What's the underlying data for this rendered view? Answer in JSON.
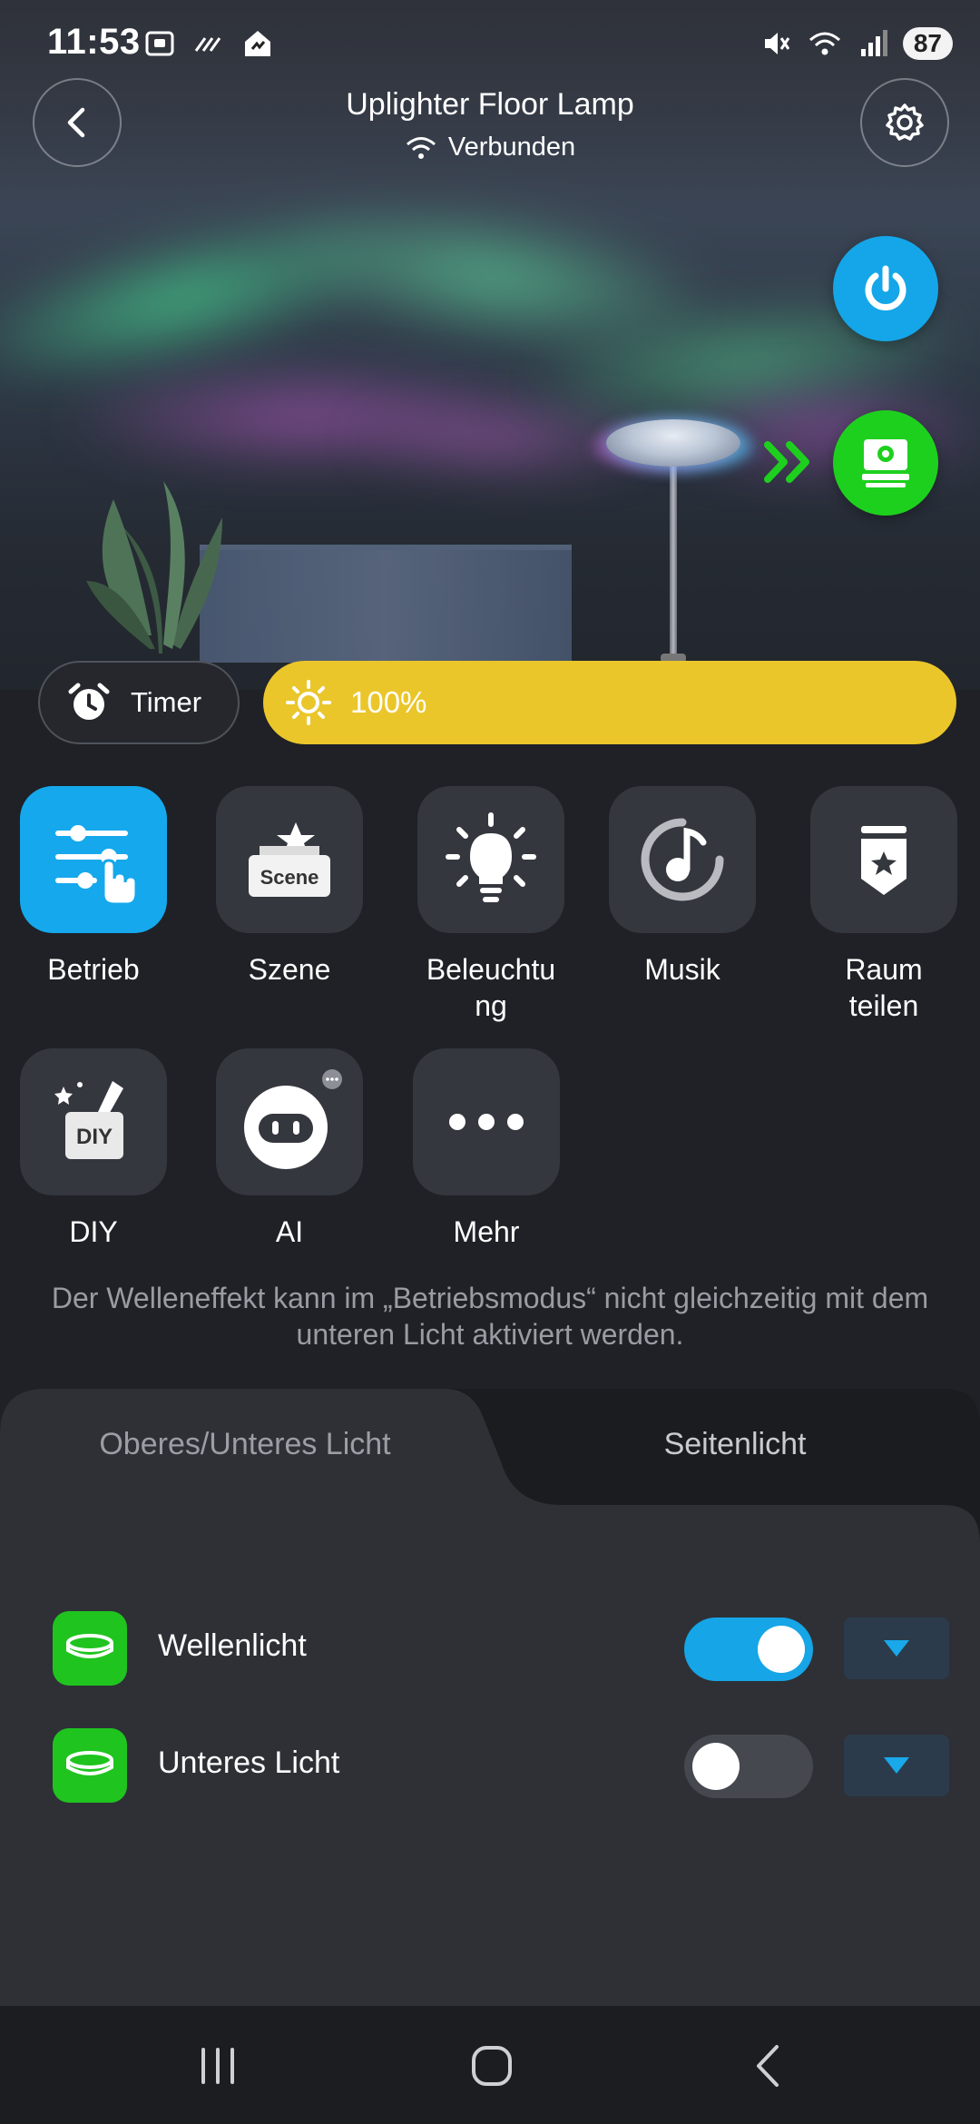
{
  "status_bar": {
    "time": "11:53",
    "battery": "87"
  },
  "header": {
    "title": "Uplighter Floor Lamp",
    "connection_status": "Verbunden"
  },
  "controls": {
    "timer_label": "Timer",
    "brightness": "100%"
  },
  "modes": [
    {
      "label": "Betrieb",
      "icon": "sliders-hand-icon",
      "active": true
    },
    {
      "label": "Szene",
      "icon": "scene-icon",
      "badge": "Scene"
    },
    {
      "label": "Beleuchtu\nng",
      "icon": "lightbulb-icon"
    },
    {
      "label": "Musik",
      "icon": "music-note-icon"
    },
    {
      "label": "Raum\nteilen",
      "icon": "share-room-icon"
    },
    {
      "label": "DIY",
      "icon": "diy-icon",
      "badge": "DIY"
    },
    {
      "label": "AI",
      "icon": "ai-robot-icon"
    },
    {
      "label": "Mehr",
      "icon": "more-dots-icon"
    }
  ],
  "notice": "Der Welleneffekt kann im „Betriebsmodus“ nicht gleichzeitig mit dem unteren Licht aktiviert werden.",
  "tabs": {
    "upper_lower": "Oberes/Unteres Licht",
    "side": "Seitenlicht"
  },
  "lights": [
    {
      "name": "Wellenlicht",
      "on": true
    },
    {
      "name": "Unteres Licht",
      "on": false
    }
  ],
  "colors": {
    "accent_blue": "#15a8ec",
    "brightness_yellow": "#eac62b",
    "green": "#1ed01e",
    "panel": "#2e3036"
  }
}
